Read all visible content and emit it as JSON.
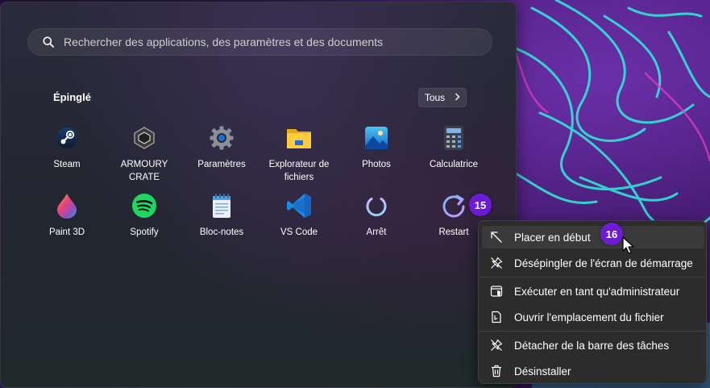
{
  "search": {
    "placeholder": "Rechercher des applications, des paramètres et des documents",
    "icon": "search-icon"
  },
  "pinned": {
    "title": "Épinglé",
    "all_button": {
      "label": "Tous",
      "icon": "chevron-right-icon"
    },
    "apps": [
      {
        "label": "Steam",
        "icon": "steam-icon"
      },
      {
        "label": "ARMOURY CRATE",
        "icon": "armoury-crate-icon"
      },
      {
        "label": "Paramètres",
        "icon": "gear-icon"
      },
      {
        "label": "Explorateur de fichiers",
        "icon": "folder-icon"
      },
      {
        "label": "Photos",
        "icon": "photos-icon"
      },
      {
        "label": "Calculatrice",
        "icon": "calculator-icon"
      },
      {
        "label": "Paint 3D",
        "icon": "paint3d-icon"
      },
      {
        "label": "Spotify",
        "icon": "spotify-icon"
      },
      {
        "label": "Bloc-notes",
        "icon": "notepad-icon"
      },
      {
        "label": "VS Code",
        "icon": "vscode-icon"
      },
      {
        "label": "Arrêt",
        "icon": "power-icon"
      },
      {
        "label": "Restart",
        "icon": "restart-icon"
      }
    ]
  },
  "badges": {
    "restart": "15",
    "menu_first": "16"
  },
  "context_menu": {
    "items": [
      {
        "label": "Placer en début",
        "icon": "arrow-up-left-icon"
      },
      {
        "label": "Désépingler de l'écran de démarrage",
        "icon": "unpin-icon"
      },
      {
        "label": "Exécuter en tant qu'administrateur",
        "icon": "admin-shield-icon"
      },
      {
        "label": "Ouvrir l'emplacement du fichier",
        "icon": "open-location-icon"
      },
      {
        "label": "Détacher de la barre des tâches",
        "icon": "unpin-taskbar-icon"
      },
      {
        "label": "Désinstaller",
        "icon": "trash-icon"
      }
    ]
  },
  "colors": {
    "badge": "#6d1bd6",
    "wallpaper_accent": "#2ee6d6",
    "vscode_blue": "#1e88e5",
    "spotify_green": "#1ed760"
  }
}
